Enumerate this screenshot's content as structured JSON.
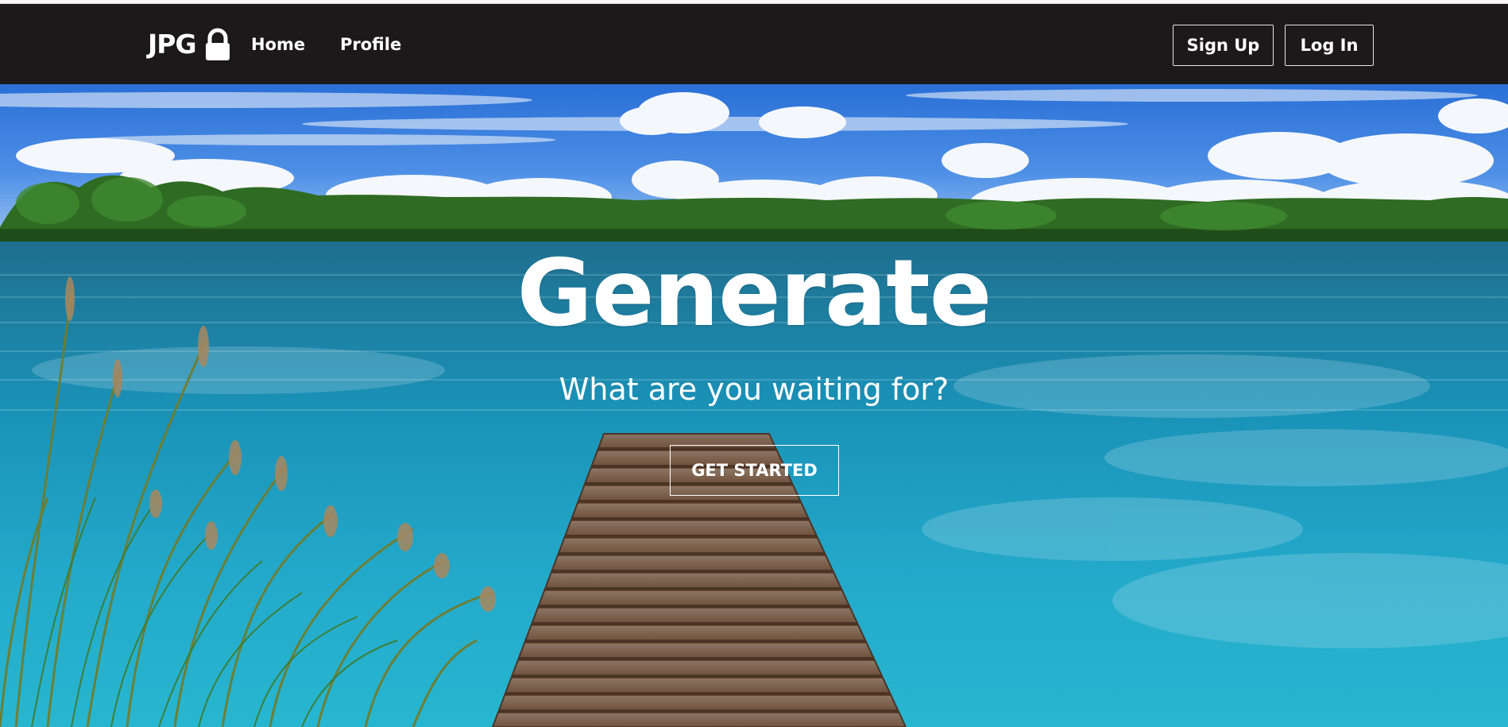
{
  "navbar": {
    "brand": "JPG",
    "brand_icon": "lock-icon",
    "links": [
      "Home",
      "Profile"
    ],
    "signup_label": "Sign Up",
    "login_label": "Log In",
    "background": "#1b191a"
  },
  "hero": {
    "title": "Generate",
    "subtitle": "What are you waiting for?",
    "cta_label": "GET STARTED",
    "background": "lake-with-wooden-pier-photo"
  }
}
